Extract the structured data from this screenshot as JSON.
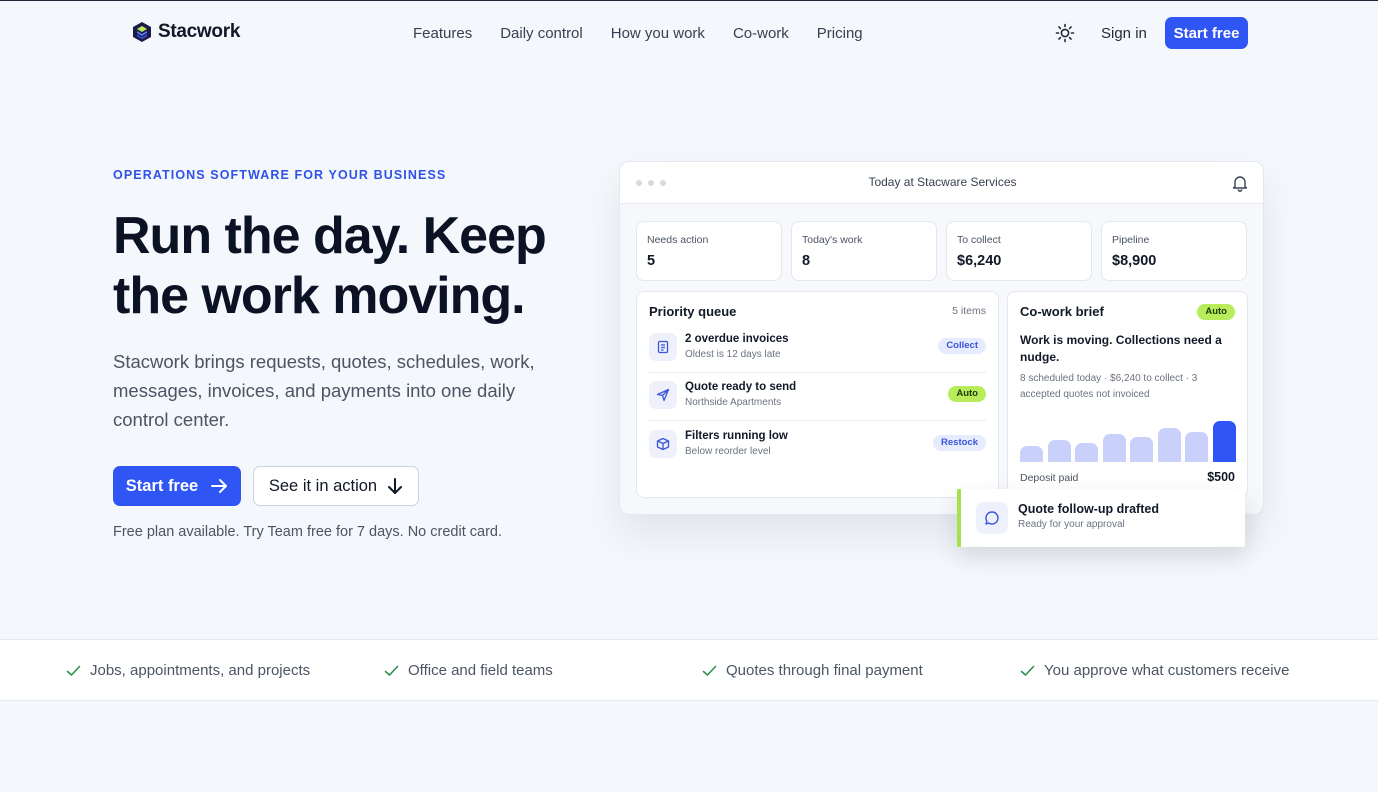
{
  "brand": {
    "name": "Stacwork",
    "accent": "#2f55f5",
    "accent_green": "#b8ec5a"
  },
  "nav": {
    "links": [
      "Features",
      "Daily control",
      "How you work",
      "Co-work",
      "Pricing"
    ],
    "theme_icon": "sun-icon",
    "signin": "Sign in",
    "cta": "Start free"
  },
  "hero": {
    "eyebrow": "OPERATIONS SOFTWARE FOR YOUR BUSINESS",
    "headline": "Run the day. Keep the work moving.",
    "subtext": "Stacwork brings requests, quotes, schedules, work, messages, invoices, and payments into one daily control center.",
    "primary_cta": "Start free",
    "secondary_cta": "See it in action",
    "footnote": "Free plan available. Try Team free for 7 days. No credit card."
  },
  "dashboard": {
    "title": "Today at Stacware Services",
    "stats": [
      {
        "label": "Needs action",
        "value": "5"
      },
      {
        "label": "Today's work",
        "value": "8"
      },
      {
        "label": "To collect",
        "value": "$6,240"
      },
      {
        "label": "Pipeline",
        "value": "$8,900"
      }
    ],
    "queue": {
      "title": "Priority queue",
      "count": "5 items",
      "items": [
        {
          "icon": "invoice-icon",
          "title": "2 overdue invoices",
          "subtitle": "Oldest is 12 days late",
          "badge": "Collect",
          "badge_style": "blue"
        },
        {
          "icon": "send-icon",
          "title": "Quote ready to send",
          "subtitle": "Northside Apartments",
          "badge": "Auto",
          "badge_style": "green"
        },
        {
          "icon": "package-icon",
          "title": "Filters running low",
          "subtitle": "Below reorder level",
          "badge": "Restock",
          "badge_style": "blue"
        }
      ]
    },
    "brief": {
      "title": "Co-work brief",
      "badge": "Auto",
      "headline": "Work is moving. Collections need a nudge.",
      "detail": "8 scheduled today · $6,240 to collect · 3 accepted quotes not invoiced",
      "bars": [
        0.38,
        0.52,
        0.45,
        0.66,
        0.6,
        0.8,
        0.72,
        0.98
      ],
      "footer_label": "Deposit paid",
      "footer_value": "$500"
    },
    "toast": {
      "icon": "chat-bubble-icon",
      "title": "Quote follow-up drafted",
      "subtitle": "Ready for your approval"
    }
  },
  "features": [
    "Jobs, appointments, and projects",
    "Office and field teams",
    "Quotes through final payment",
    "You approve what customers receive"
  ]
}
